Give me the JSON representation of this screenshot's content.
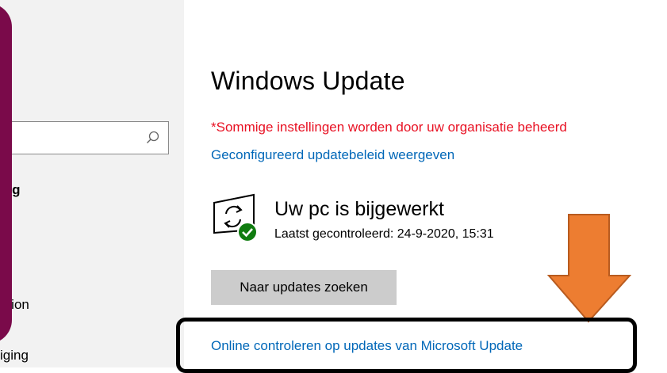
{
  "sidebar": {
    "search": {
      "placeholder": ""
    },
    "heading_fragment": "ing",
    "items": [
      {
        "label": "ation"
      },
      {
        "label": "iging"
      }
    ]
  },
  "main": {
    "title": "Windows Update",
    "org_warning": "*Sommige instellingen worden door uw organisatie beheerd",
    "policy_link": "Geconfigureerd updatebeleid weergeven",
    "status": {
      "title": "Uw pc is bijgewerkt",
      "last_checked": "Laatst gecontroleerd: 24-9-2020, 15:31",
      "icon": "update-sync-check-icon"
    },
    "check_button": "Naar updates zoeken",
    "online_link": "Online controleren op updates van Microsoft Update"
  },
  "colors": {
    "warning": "#e81123",
    "link": "#0067b8",
    "arrow": "#ed7d31",
    "sidebar_accent": "#7a0a4a",
    "check_badge": "#107c10"
  }
}
